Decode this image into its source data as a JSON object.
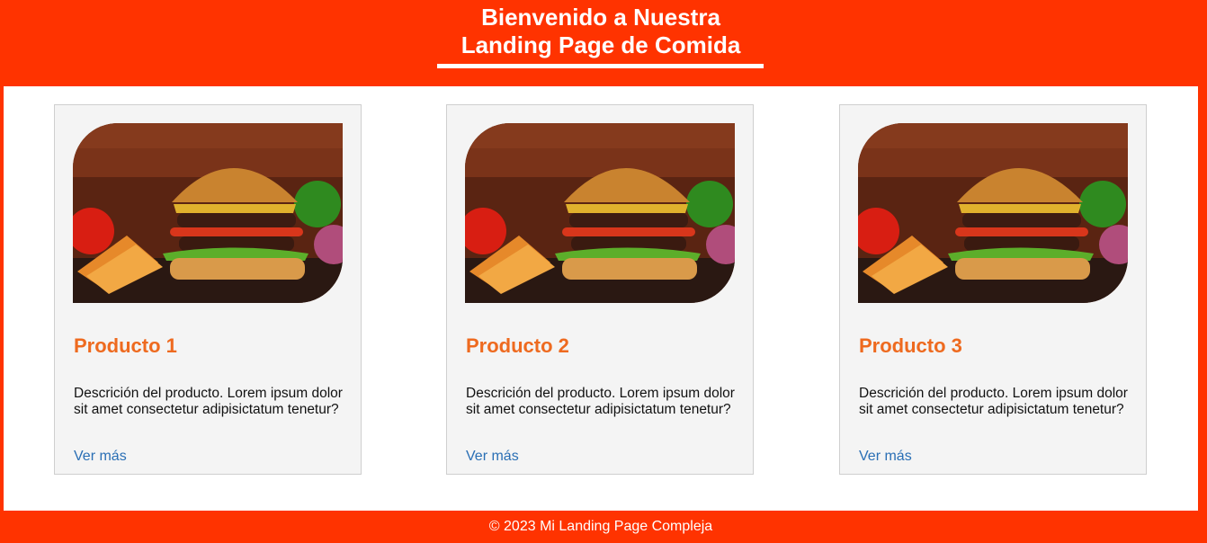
{
  "header": {
    "title_line1": "Bienvenido a Nuestra",
    "title_line2": "Landing Page de Comida"
  },
  "products": [
    {
      "title": "Producto 1",
      "description": "Descrición del producto. Lorem ipsum dolor sit amet consectetur adipisictatum tenetur?",
      "link": "Ver más",
      "image_alt": "burger-image"
    },
    {
      "title": "Producto 2",
      "description": "Descrición del producto. Lorem ipsum dolor sit amet consectetur adipisictatum tenetur?",
      "link": "Ver más",
      "image_alt": "burger-image"
    },
    {
      "title": "Producto 3",
      "description": "Descrición del producto. Lorem ipsum dolor sit amet consectetur adipisictatum tenetur?",
      "link": "Ver más",
      "image_alt": "burger-image"
    }
  ],
  "footer": {
    "text": "© 2023 Mi Landing Page Compleja"
  },
  "colors": {
    "brand": "#ff3300",
    "product_title": "#ee6a1f",
    "link": "#2a6fb5",
    "card_bg": "#f4f4f4"
  }
}
